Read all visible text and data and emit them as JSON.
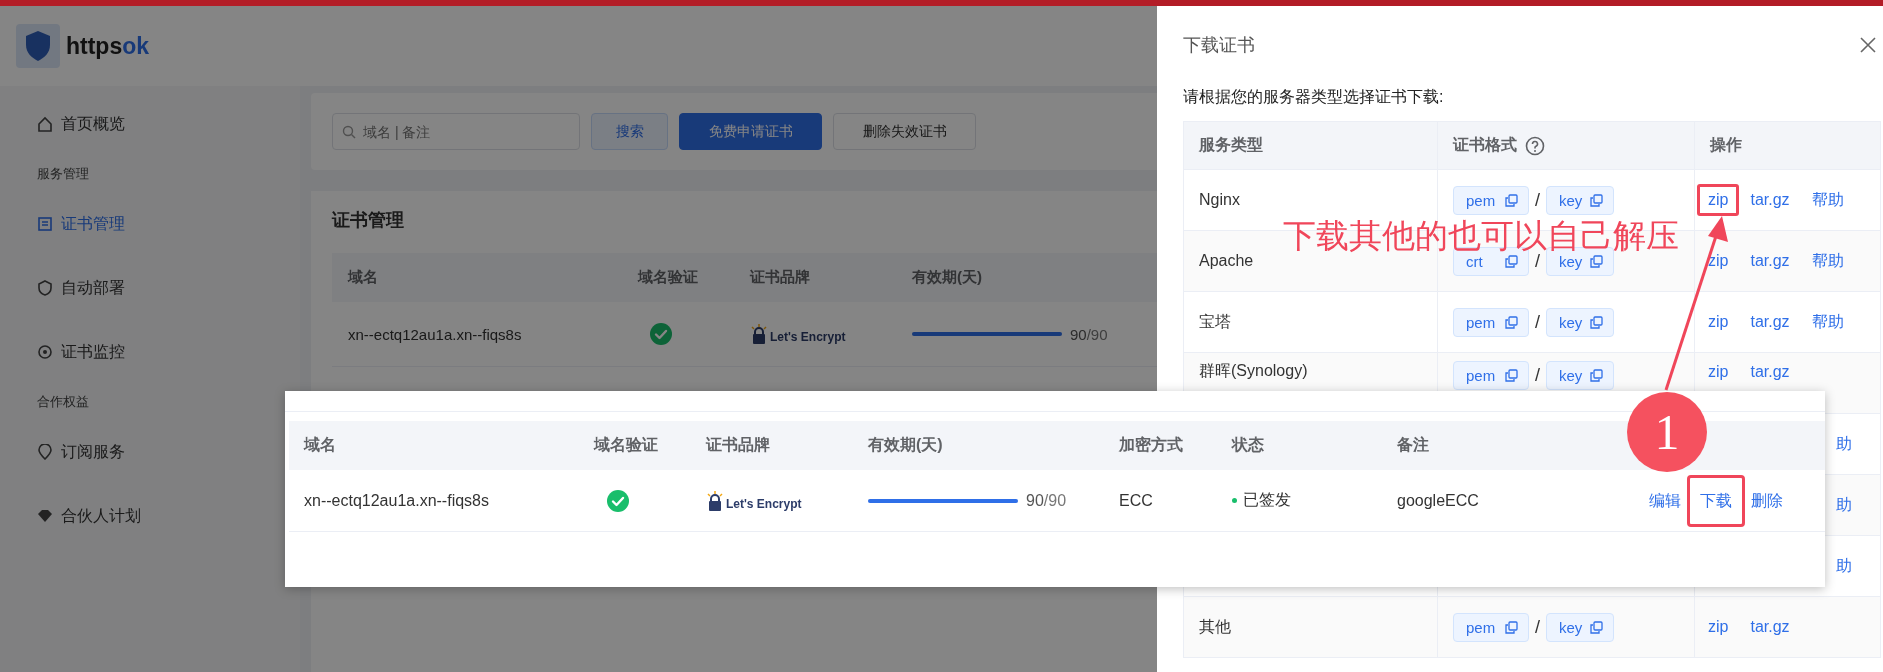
{
  "app": {
    "logo": {
      "text": "https",
      "accent": "ok"
    },
    "sidebar": [
      {
        "kind": "item",
        "label": "首页概览",
        "selected": false
      },
      {
        "kind": "group",
        "label": "服务管理"
      },
      {
        "kind": "item",
        "label": "证书管理",
        "selected": true
      },
      {
        "kind": "item",
        "label": "自动部署",
        "selected": false
      },
      {
        "kind": "item",
        "label": "证书监控",
        "selected": false
      },
      {
        "kind": "group",
        "label": "合作权益"
      },
      {
        "kind": "item",
        "label": "订阅服务",
        "selected": false
      },
      {
        "kind": "item",
        "label": "合伙人计划",
        "selected": false
      }
    ],
    "toolbar": {
      "search_placeholder": "域名 | 备注",
      "buttons": [
        {
          "label": "搜索",
          "kind": "light"
        },
        {
          "label": "免费申请证书",
          "kind": "primary"
        },
        {
          "label": "删除失效证书",
          "kind": "plain"
        }
      ]
    },
    "certificates": {
      "title": "证书管理",
      "columns": [
        "域名",
        "域名验证",
        "证书品牌",
        "有效期(天)"
      ],
      "rows": [
        {
          "domain": "xn--ectq12au1a.xn--fiqs8s",
          "verified": true,
          "brand": "Let's Encrypt",
          "level": 1,
          "days": "90",
          "total": "/90"
        }
      ]
    }
  },
  "drawer": {
    "title": "下载证书",
    "subtitle": "请根据您的服务器类型选择证书下载:",
    "columns": [
      "服务类型",
      "证书格式",
      "操作"
    ],
    "rows": [
      {
        "kind": "full",
        "server": "Nginx",
        "formats": [
          "pem",
          "key"
        ],
        "separator": "/",
        "actions": [
          {
            "label": "zip",
            "highlighted": true
          },
          {
            "label": "tar.gz",
            "highlighted": false
          },
          {
            "label": "帮助",
            "highlighted": false
          }
        ]
      },
      {
        "kind": "full",
        "server": "Apache",
        "formats": [
          "crt",
          "key"
        ],
        "separator": "/",
        "actions": [
          {
            "label": "zip",
            "highlighted": false
          },
          {
            "label": "tar.gz",
            "highlighted": false
          },
          {
            "label": "帮助",
            "highlighted": false
          }
        ]
      },
      {
        "kind": "full",
        "server": "宝塔",
        "formats": [
          "pem",
          "key"
        ],
        "separator": "/",
        "actions": [
          {
            "label": "zip",
            "highlighted": false
          },
          {
            "label": "tar.gz",
            "highlighted": false
          },
          {
            "label": "帮助",
            "highlighted": false
          }
        ]
      },
      {
        "kind": "partial",
        "server": "群晖(Synology)",
        "formats": [
          "pem",
          "key"
        ],
        "separator": "/",
        "actions": [
          {
            "label": "zip",
            "highlighted": false
          },
          {
            "label": "tar.gz",
            "highlighted": false
          }
        ]
      },
      {
        "kind": "covered",
        "actions": [
          {
            "label": "助",
            "highlighted": false
          }
        ]
      },
      {
        "kind": "covered",
        "actions": [
          {
            "label": "助",
            "highlighted": false
          }
        ]
      },
      {
        "kind": "covered",
        "actions": [
          {
            "label": "助",
            "highlighted": false
          }
        ]
      },
      {
        "kind": "full",
        "server": "其他",
        "formats": [
          "pem",
          "key"
        ],
        "separator": "/",
        "actions": [
          {
            "label": "zip",
            "highlighted": false
          },
          {
            "label": "tar.gz",
            "highlighted": false
          }
        ]
      }
    ]
  },
  "overlay_card": {
    "columns": [
      "域名",
      "域名验证",
      "证书品牌",
      "有效期(天)",
      "加密方式",
      "状态",
      "备注"
    ],
    "rows": [
      {
        "domain": "xn--ectq12au1a.xn--fiqs8s",
        "verified": true,
        "brand": "Let's Encrypt",
        "level": 1,
        "days": "90",
        "total": "/90",
        "encryption": "ECC",
        "status": "已签发",
        "color": "#19be6b",
        "note": "googleECC",
        "actions": [
          {
            "label": "编辑",
            "highlighted": false
          },
          {
            "label": "下载",
            "highlighted": true
          },
          {
            "label": "删除",
            "highlighted": false
          }
        ]
      }
    ]
  },
  "annotations": {
    "note": "下载其他的也可以自己解压",
    "step": "1"
  }
}
